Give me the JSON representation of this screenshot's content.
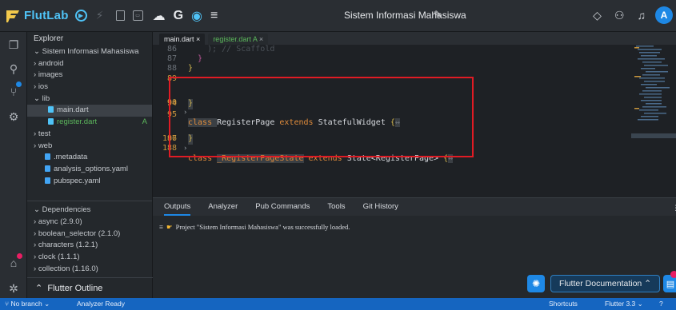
{
  "app": {
    "logo_text": "FlutLab",
    "title": "Sistem Informasi Mahasiswa",
    "avatar_letter": "A",
    "accent": "#1e88e5",
    "icons": [
      "run-icon",
      "flash-icon",
      "stop-icon",
      "device-icon",
      "cloud-icon",
      "google-icon",
      "record-icon",
      "menu-icon",
      "pencil-icon",
      "layers-icon",
      "add-user-icon",
      "bell-icon"
    ]
  },
  "activity": {
    "icons": [
      "files-icon",
      "search-icon",
      "source-control-icon",
      "settings-icon",
      "extension-icon",
      "debug-icon"
    ]
  },
  "explorer": {
    "header": "Explorer",
    "items": [
      {
        "label": "Sistem Informasi Mahasiswa"
      },
      {
        "label": "android"
      },
      {
        "label": "images"
      },
      {
        "label": "ios"
      },
      {
        "label": "lib"
      },
      {
        "label": "main.dart"
      },
      {
        "label": "register.dart",
        "status": "A"
      },
      {
        "label": "test"
      },
      {
        "label": "web"
      },
      {
        "label": ".metadata"
      },
      {
        "label": "analysis_options.yaml"
      },
      {
        "label": "pubspec.yaml"
      }
    ],
    "dependencies_header": "Dependencies",
    "dependencies": [
      {
        "label": "async (2.9.0)"
      },
      {
        "label": "boolean_selector (2.1.0)"
      },
      {
        "label": "characters (1.2.1)"
      },
      {
        "label": "clock (1.1.1)"
      },
      {
        "label": "collection (1.16.0)"
      }
    ],
    "outline": "Flutter Outline"
  },
  "editor": {
    "tabs": [
      {
        "label": "main.dart",
        "close": "×"
      },
      {
        "label": "register.dart A",
        "close": "×"
      }
    ],
    "lines": [
      {
        "num": "86",
        "text": "    ); // Scaffold"
      },
      {
        "num": "87",
        "text": "  }"
      },
      {
        "num": "88",
        "text": "}"
      },
      {
        "num": "89",
        "text": ""
      },
      {
        "num": "90",
        "pre": "class ",
        "name": "RegisterPage",
        "mid": " extends ",
        "name2": "StatefulWidget",
        "brace": " {",
        "tail": "↔"
      },
      {
        "num": "94",
        "text": "}"
      },
      {
        "num": "95",
        "text": ""
      },
      {
        "num": "96",
        "pre": "class ",
        "name": "_RegisterPageState",
        "mid": " extends ",
        "name2": "State<RegisterPage>",
        "brace": " {",
        "tail": "↔"
      },
      {
        "num": "187",
        "text": "}"
      },
      {
        "num": "188",
        "text": ""
      }
    ]
  },
  "panel": {
    "tabs": [
      "Outputs",
      "Analyzer",
      "Pub Commands",
      "Tools",
      "Git History"
    ],
    "message": "Project \"Sistem Informasi Mahasiswa\" was successfully loaded.",
    "docs_button": "Flutter Documentation"
  },
  "statusbar": {
    "branch": "No branch",
    "analyzer": "Analyzer Ready",
    "shortcuts": "Shortcuts",
    "flutter": "Flutter 3.3"
  }
}
